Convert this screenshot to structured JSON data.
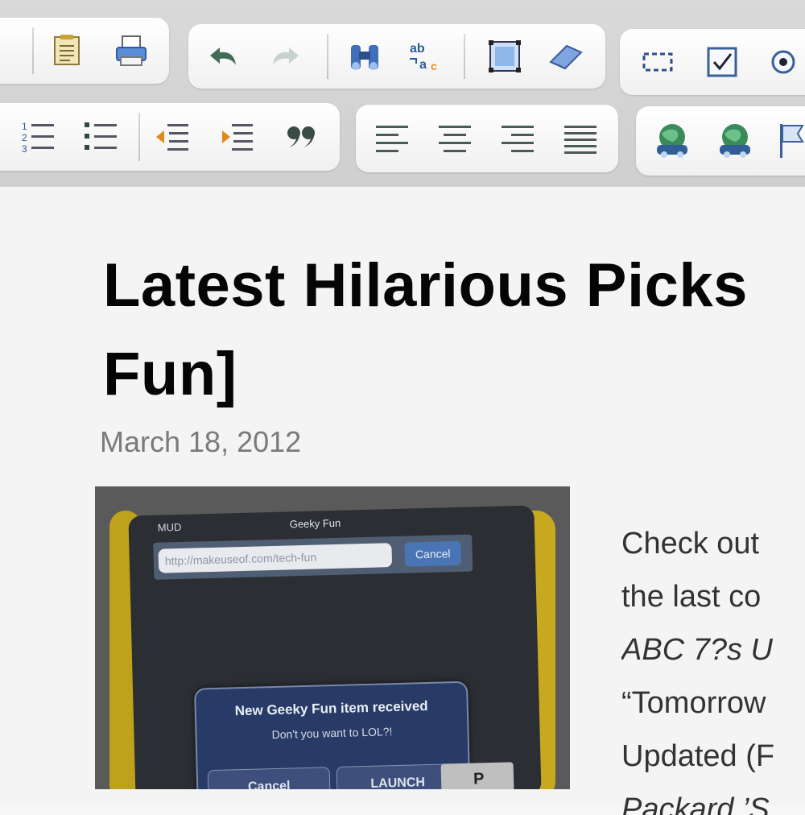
{
  "toolbar": {
    "row1": {
      "group1": [
        {
          "icon": "paste-icon"
        },
        {
          "icon": "print-icon"
        }
      ],
      "group2": [
        {
          "icon": "undo-icon"
        },
        {
          "icon": "redo-icon"
        },
        {
          "icon": "find-icon"
        },
        {
          "icon": "replace-icon"
        },
        {
          "icon": "select-all-icon"
        },
        {
          "icon": "eraser-icon"
        }
      ],
      "group3": [
        {
          "icon": "dashed-box-icon"
        },
        {
          "icon": "checkbox-icon"
        },
        {
          "icon": "radio-icon"
        }
      ]
    },
    "row2": {
      "group1": [
        {
          "icon": "numbered-list-icon"
        },
        {
          "icon": "bulleted-list-icon"
        },
        {
          "icon": "outdent-icon"
        },
        {
          "icon": "indent-icon"
        },
        {
          "icon": "blockquote-icon"
        }
      ],
      "group2": [
        {
          "icon": "align-left-icon"
        },
        {
          "icon": "align-center-icon"
        },
        {
          "icon": "align-right-icon"
        },
        {
          "icon": "justify-icon"
        }
      ],
      "group3": [
        {
          "icon": "link-icon"
        },
        {
          "icon": "unlink-icon"
        },
        {
          "icon": "anchor-flag-icon"
        }
      ]
    },
    "accent_color": "#3c6f9e"
  },
  "article": {
    "title": "Latest Hilarious Picks\nFun]",
    "date": "March 18, 2012",
    "image": {
      "status": "MUD",
      "app_title": "Geeky Fun",
      "url": "http://makeuseof.com/tech-fun",
      "cancel_top": "Cancel",
      "alert_title": "New Geeky Fun item received",
      "alert_message": "Don't you want to LOL?!",
      "cancel_label": "Cancel",
      "launch_label": "LAUNCH",
      "key_label": "P"
    },
    "text_lines": [
      "Check out",
      "the last co",
      "ABC 7?s U",
      "“Tomorrow",
      "Updated (F",
      "Packard ’S"
    ]
  }
}
